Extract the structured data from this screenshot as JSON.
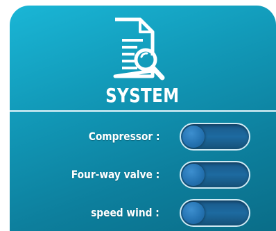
{
  "panel": {
    "title": "SYSTEM",
    "icon": "document-search-icon"
  },
  "rows": [
    {
      "label": "Compressor :",
      "state": "off"
    },
    {
      "label": "Four-way valve :",
      "state": "off"
    },
    {
      "label": "speed wind :",
      "state": "off"
    }
  ],
  "colors": {
    "panel_top": "#1ab6d6",
    "panel_bottom": "#0a6d88",
    "toggle_track": "#1d6aa0",
    "toggle_border": "#cfeaf4",
    "text": "#ffffff"
  }
}
